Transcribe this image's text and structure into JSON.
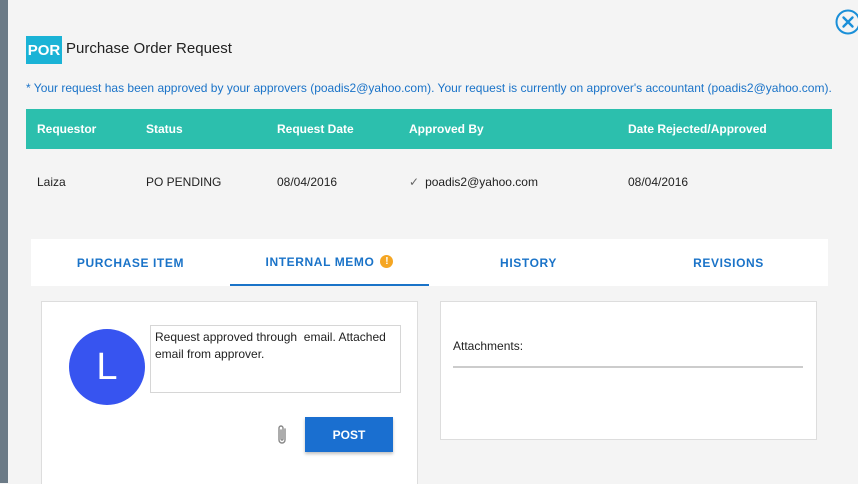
{
  "header": {
    "logo": "POR",
    "title": "Purchase Order Request",
    "close_icon": "close-circle-icon"
  },
  "notice": "* Your request has been approved by your approvers (poadis2@yahoo.com). Your request is currently on approver's accountant (poadis2@yahoo.com).",
  "table": {
    "columns": [
      "Requestor",
      "Status",
      "Request Date",
      "Approved By",
      "Date Rejected/Approved"
    ],
    "rows": [
      [
        "Laiza",
        "PO PENDING",
        "08/04/2016",
        "poadis2@yahoo.com",
        "08/04/2016"
      ]
    ],
    "approved_icon": "checkmark-icon"
  },
  "tabs": [
    {
      "label": "PURCHASE ITEM"
    },
    {
      "label": "INTERNAL MEMO",
      "badge": "!"
    },
    {
      "label": "HISTORY"
    },
    {
      "label": "REVISIONS"
    }
  ],
  "memo": {
    "avatar_initial": "L",
    "text": "Request approved through  email. Attached email from approver.",
    "attach_icon": "paperclip-icon",
    "post_label": "POST"
  },
  "attachments": {
    "label": "Attachments:"
  },
  "colors": {
    "accent": "#1a73c8",
    "table_header": "#2cbfad",
    "logo": "#1ab3d6",
    "avatar": "#3754f0",
    "warning": "#f5a623"
  }
}
